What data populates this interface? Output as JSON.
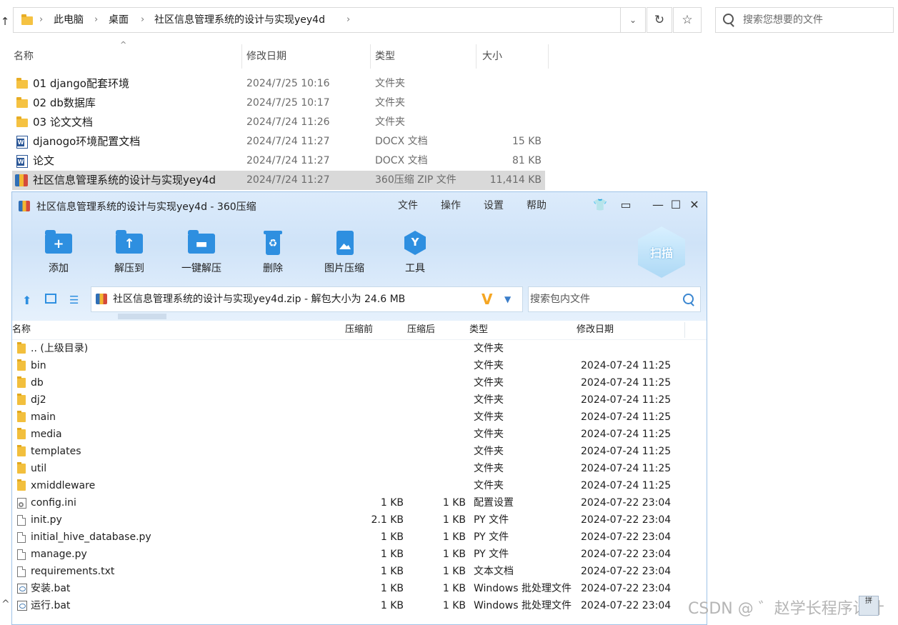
{
  "explorer": {
    "breadcrumbs": [
      "此电脑",
      "桌面",
      "社区信息管理系统的设计与实现yey4d"
    ],
    "search_placeholder": "搜索您想要的文件",
    "columns": {
      "name": "名称",
      "date": "修改日期",
      "type": "类型",
      "size": "大小"
    },
    "rows": [
      {
        "name": "01 django配套环境",
        "date": "2024/7/25 10:16",
        "type": "文件夹",
        "size": "",
        "icon": "folder-icon"
      },
      {
        "name": "02 db数据库",
        "date": "2024/7/25 10:17",
        "type": "文件夹",
        "size": "",
        "icon": "folder-icon"
      },
      {
        "name": "03 论文文档",
        "date": "2024/7/24 11:26",
        "type": "文件夹",
        "size": "",
        "icon": "folder-icon"
      },
      {
        "name": "djanogo环境配置文档",
        "date": "2024/7/24 11:27",
        "type": "DOCX 文档",
        "size": "15 KB",
        "icon": "word-doc-icon"
      },
      {
        "name": "论文",
        "date": "2024/7/24 11:27",
        "type": "DOCX 文档",
        "size": "81 KB",
        "icon": "word-doc-icon"
      },
      {
        "name": "社区信息管理系统的设计与实现yey4d",
        "date": "2024/7/24 11:27",
        "type": "360压缩 ZIP 文件",
        "size": "11,414 KB",
        "icon": "zip-icon",
        "selected": true
      }
    ]
  },
  "zip_window": {
    "title": "社区信息管理系统的设计与实现yey4d - 360压缩",
    "menu": [
      "文件",
      "操作",
      "设置",
      "帮助"
    ],
    "toolbar": [
      {
        "label": "添加",
        "icon": "add-folder-icon"
      },
      {
        "label": "解压到",
        "icon": "extract-to-icon"
      },
      {
        "label": "一键解压",
        "icon": "one-click-extract-icon"
      },
      {
        "label": "删除",
        "icon": "recycle-bin-icon"
      },
      {
        "label": "图片压缩",
        "icon": "image-compress-icon"
      },
      {
        "label": "工具",
        "icon": "tools-icon"
      }
    ],
    "scan_label": "扫描",
    "path_text": "社区信息管理系统的设计与实现yey4d.zip - 解包大小为 24.6 MB",
    "search_placeholder": "搜索包内文件",
    "columns": {
      "name": "名称",
      "before": "压缩前",
      "after": "压缩后",
      "type": "类型",
      "date": "修改日期"
    },
    "rows": [
      {
        "name": ".. (上级目录)",
        "before": "",
        "after": "",
        "type": "文件夹",
        "date": "",
        "icon": "folder-icon"
      },
      {
        "name": "bin",
        "before": "",
        "after": "",
        "type": "文件夹",
        "date": "2024-07-24 11:25",
        "icon": "folder-icon"
      },
      {
        "name": "db",
        "before": "",
        "after": "",
        "type": "文件夹",
        "date": "2024-07-24 11:25",
        "icon": "folder-icon"
      },
      {
        "name": "dj2",
        "before": "",
        "after": "",
        "type": "文件夹",
        "date": "2024-07-24 11:25",
        "icon": "folder-icon"
      },
      {
        "name": "main",
        "before": "",
        "after": "",
        "type": "文件夹",
        "date": "2024-07-24 11:25",
        "icon": "folder-icon"
      },
      {
        "name": "media",
        "before": "",
        "after": "",
        "type": "文件夹",
        "date": "2024-07-24 11:25",
        "icon": "folder-icon"
      },
      {
        "name": "templates",
        "before": "",
        "after": "",
        "type": "文件夹",
        "date": "2024-07-24 11:25",
        "icon": "folder-icon"
      },
      {
        "name": "util",
        "before": "",
        "after": "",
        "type": "文件夹",
        "date": "2024-07-24 11:25",
        "icon": "folder-icon"
      },
      {
        "name": "xmiddleware",
        "before": "",
        "after": "",
        "type": "文件夹",
        "date": "2024-07-24 11:25",
        "icon": "folder-icon"
      },
      {
        "name": "config.ini",
        "before": "1 KB",
        "after": "1 KB",
        "type": "配置设置",
        "date": "2024-07-22 23:04",
        "icon": "settings-file-icon"
      },
      {
        "name": "init.py",
        "before": "2.1 KB",
        "after": "1 KB",
        "type": "PY 文件",
        "date": "2024-07-22 23:04",
        "icon": "file-icon"
      },
      {
        "name": "initial_hive_database.py",
        "before": "1 KB",
        "after": "1 KB",
        "type": "PY 文件",
        "date": "2024-07-22 23:04",
        "icon": "file-icon"
      },
      {
        "name": "manage.py",
        "before": "1 KB",
        "after": "1 KB",
        "type": "PY 文件",
        "date": "2024-07-22 23:04",
        "icon": "file-icon"
      },
      {
        "name": "requirements.txt",
        "before": "1 KB",
        "after": "1 KB",
        "type": "文本文档",
        "date": "2024-07-22 23:04",
        "icon": "text-file-icon"
      },
      {
        "name": "安装.bat",
        "before": "1 KB",
        "after": "1 KB",
        "type": "Windows 批处理文件",
        "date": "2024-07-22 23:04",
        "icon": "batch-file-icon"
      },
      {
        "name": "运行.bat",
        "before": "1 KB",
        "after": "1 KB",
        "type": "Windows 批处理文件",
        "date": "2024-07-22 23:04",
        "icon": "batch-file-icon"
      }
    ]
  },
  "watermark": "CSDN @ ゛赵学长程序设计",
  "ime_label": "拼"
}
